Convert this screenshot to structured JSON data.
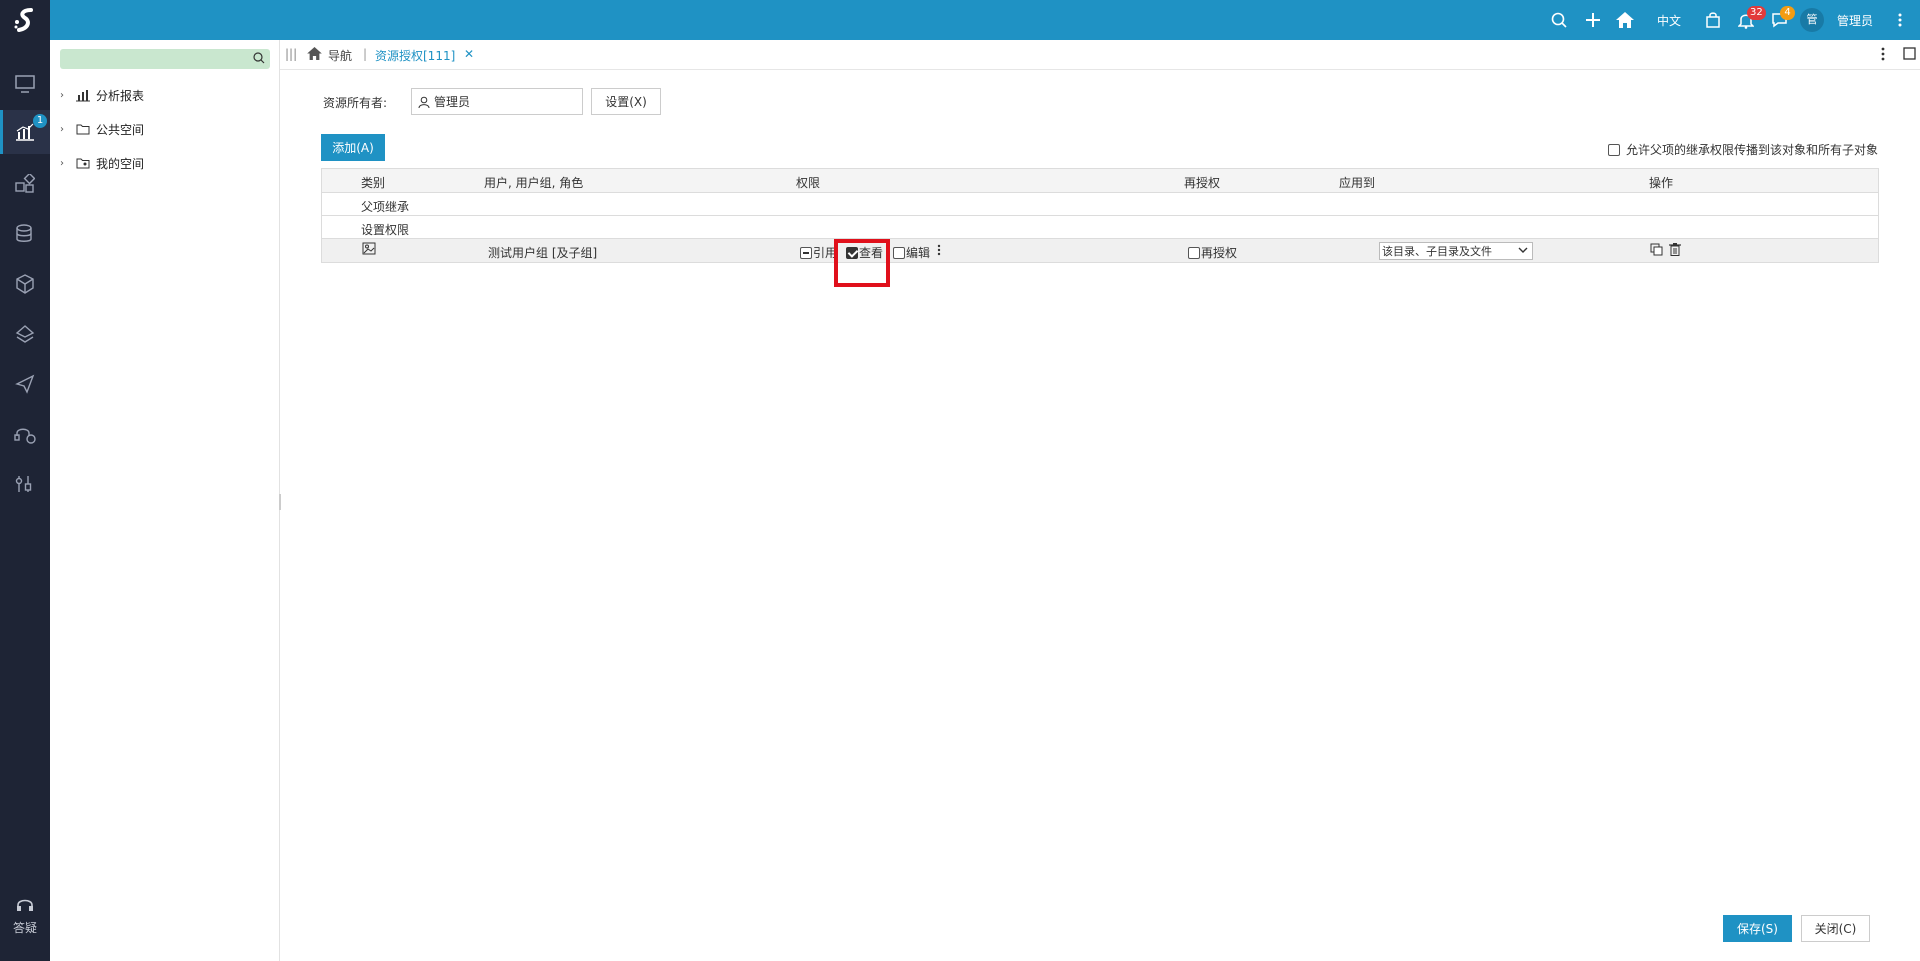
{
  "topbar": {
    "language": "中文",
    "notification_count": "32",
    "message_count": "4",
    "avatar_text": "管",
    "user_name": "管理员",
    "icons": [
      "search-icon",
      "plus-icon",
      "home-icon",
      "bag-icon",
      "bell-icon",
      "chat-icon",
      "more-vertical-icon"
    ]
  },
  "rail": {
    "active_badge": "1",
    "help_label": "答疑",
    "items": [
      "monitor-icon",
      "analytics-icon",
      "widgets-icon",
      "database-icon",
      "cube-icon",
      "layers-icon",
      "send-icon",
      "support-icon",
      "tools-icon"
    ]
  },
  "tree": {
    "nodes": [
      {
        "label": "分析报表",
        "icon": "report-icon"
      },
      {
        "label": "公共空间",
        "icon": "folder-icon"
      },
      {
        "label": "我的空间",
        "icon": "user-folder-icon"
      }
    ]
  },
  "tabs": {
    "nav_label": "导航",
    "active_tab": "资源授权[111]"
  },
  "form": {
    "owner_label": "资源所有者:",
    "owner_value": "管理员",
    "set_button": "设置(X)",
    "add_button": "添加(A)",
    "allow_inherit_label": "允许父项的继承权限传播到该对象和所有子对象"
  },
  "table": {
    "headers": [
      "类别",
      "用户, 用户组, 角色",
      "权限",
      "再授权",
      "应用到",
      "操作"
    ],
    "group_rows": [
      "父项继承",
      "设置权限"
    ],
    "row": {
      "name": "测试用户组 [及子组]",
      "perm_ref": "引用",
      "perm_view": "查看",
      "perm_edit": "编辑",
      "regrant": "再授权",
      "apply_to": "该目录、子目录及文件"
    }
  },
  "footer": {
    "save_button": "保存(S)",
    "close_button": "关闭(C)"
  },
  "colors": {
    "brand": "#1f92c4",
    "rail_bg": "#1e2435",
    "highlight": "#e0101b",
    "badge_red": "#e23b3b",
    "badge_orange": "#f39c12"
  }
}
